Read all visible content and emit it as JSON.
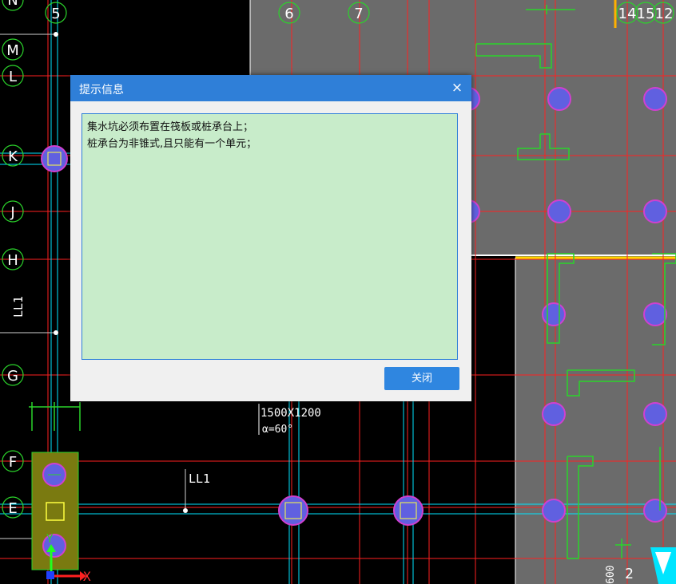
{
  "colors": {
    "canvas": "#000000",
    "slab": "#6b6b6b",
    "axis_line": "#ff2020",
    "beam_line": "#00e5ff",
    "outline_green": "#2bd42b",
    "pile_magenta": "#d040d0",
    "label_white": "#ffffff",
    "dialog_title": "#2f7fd8",
    "dialog_body": "#c8ecca"
  },
  "axis_labels": {
    "rows": [
      "N",
      "M",
      "L",
      "K",
      "J",
      "H",
      "G",
      "F",
      "E"
    ],
    "cols": [
      "5",
      "6",
      "7",
      "14",
      "15",
      "12"
    ]
  },
  "annotations": {
    "pile_size": "1500X1200",
    "angle": "α=60°",
    "beam_ll1": "LL1",
    "vertical_ll1": "LL1",
    "dim_600": "600",
    "dim_2": "2",
    "axis_x": "X",
    "axis_y": "Y"
  },
  "dialog": {
    "title": "提示信息",
    "close_symbol": "×",
    "messages": [
      "集水坑必须布置在筏板或桩承台上；",
      "桩承台为非锥式,且只能有一个单元；"
    ],
    "close_button_label": "关闭"
  }
}
